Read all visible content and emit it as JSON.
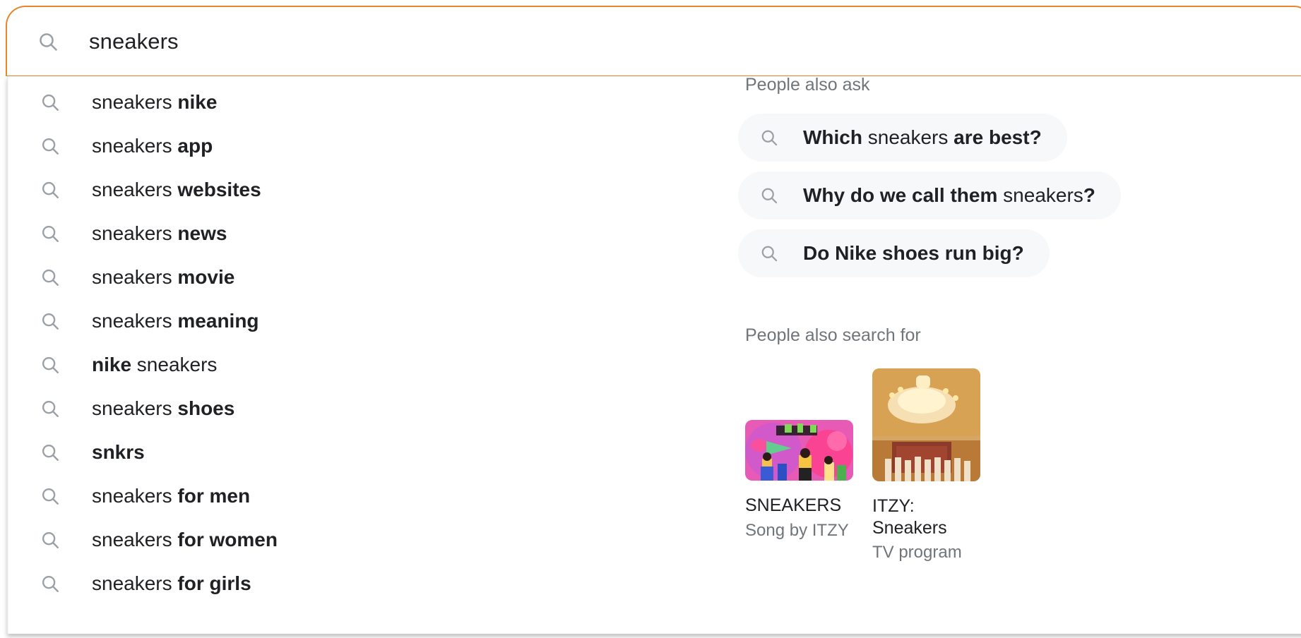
{
  "search": {
    "query": "sneakers",
    "icon": "search-icon",
    "border_color": "#e8862a"
  },
  "suggestions": {
    "icon": "search-icon",
    "items": [
      {
        "plain": "sneakers ",
        "bold": "nike",
        "bold_first": false
      },
      {
        "plain": "sneakers ",
        "bold": "app",
        "bold_first": false
      },
      {
        "plain": "sneakers ",
        "bold": "websites",
        "bold_first": false
      },
      {
        "plain": "sneakers ",
        "bold": "news",
        "bold_first": false
      },
      {
        "plain": "sneakers ",
        "bold": "movie",
        "bold_first": false
      },
      {
        "plain": "sneakers ",
        "bold": "meaning",
        "bold_first": false
      },
      {
        "plain": " sneakers",
        "bold": "nike",
        "bold_first": true
      },
      {
        "plain": "sneakers ",
        "bold": "shoes",
        "bold_first": false
      },
      {
        "plain": "",
        "bold": "snkrs",
        "bold_first": true
      },
      {
        "plain": "sneakers ",
        "bold": "for men",
        "bold_first": false
      },
      {
        "plain": "sneakers ",
        "bold": "for women",
        "bold_first": false
      },
      {
        "plain": "sneakers ",
        "bold": "for girls",
        "bold_first": false
      }
    ]
  },
  "people_also_ask": {
    "heading": "People also ask",
    "icon": "search-icon",
    "items": [
      {
        "parts": [
          {
            "t": "Which ",
            "bold": true
          },
          {
            "t": "sneakers ",
            "bold": false
          },
          {
            "t": "are best?",
            "bold": true
          }
        ]
      },
      {
        "parts": [
          {
            "t": "Why do we call them ",
            "bold": true
          },
          {
            "t": "sneakers",
            "bold": false
          },
          {
            "t": "?",
            "bold": true
          }
        ]
      },
      {
        "parts": [
          {
            "t": "Do Nike shoes run big?",
            "bold": true
          }
        ]
      }
    ]
  },
  "people_also_search_for": {
    "heading": "People also search for",
    "cards": [
      {
        "title": "SNEAKERS",
        "subtitle": "Song by ITZY",
        "thumb": "album-art-sneakers-itzy",
        "shape": "wide",
        "colors": [
          "#f06ec0",
          "#c85ac8",
          "#ff3d8a",
          "#7ed957",
          "#ffd166"
        ]
      },
      {
        "title": "ITZY: Sneakers",
        "subtitle": "TV program",
        "thumb": "ballroom-chandelier",
        "shape": "square",
        "colors": [
          "#d9a14a",
          "#f7e3b8",
          "#b06a2e",
          "#8c3b2a"
        ]
      }
    ]
  }
}
